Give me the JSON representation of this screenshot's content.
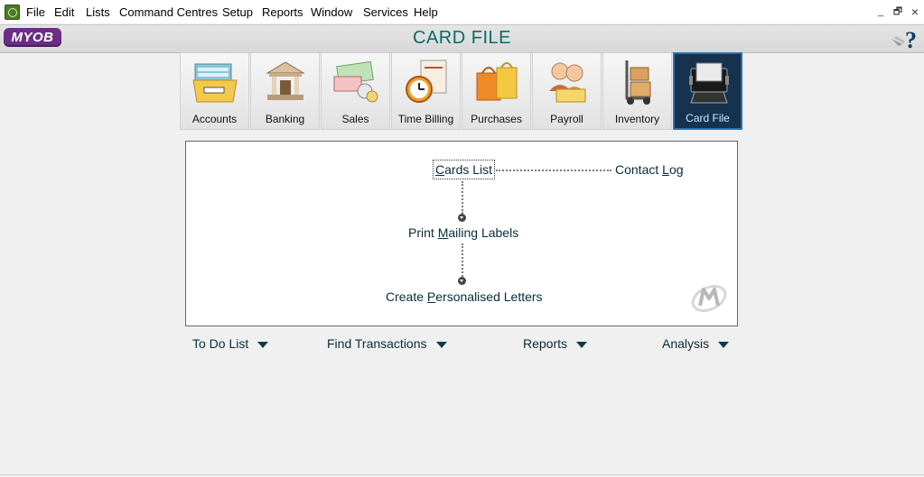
{
  "menu": {
    "items": [
      "File",
      "Edit",
      "Lists",
      "Command Centres",
      "Setup",
      "Reports",
      "Window",
      "Services",
      "Help"
    ]
  },
  "window_controls": {
    "minimize": "_",
    "restore": "🗗",
    "close": "×"
  },
  "titlebar": {
    "logo": "MYOB",
    "title": "CARD FILE",
    "help_icon": "help-question-icon"
  },
  "toolbar": {
    "buttons": [
      {
        "label": "Accounts",
        "icon": "accounts-folder-icon"
      },
      {
        "label": "Banking",
        "icon": "bank-building-icon"
      },
      {
        "label": "Sales",
        "icon": "sales-money-icon"
      },
      {
        "label": "Time Billing",
        "icon": "time-billing-clock-icon"
      },
      {
        "label": "Purchases",
        "icon": "purchases-bags-icon"
      },
      {
        "label": "Payroll",
        "icon": "payroll-people-icon"
      },
      {
        "label": "Inventory",
        "icon": "inventory-trolley-icon"
      },
      {
        "label": "Card File",
        "icon": "card-file-rolodex-icon"
      }
    ],
    "active": "Card File"
  },
  "flow": {
    "cards_list": {
      "pre": "",
      "ul": "C",
      "post": "ards List"
    },
    "contact_log": {
      "pre": "Contact ",
      "ul": "L",
      "post": "og"
    },
    "print_mailing_labels": {
      "pre": "Print ",
      "ul": "M",
      "post": "ailing Labels"
    },
    "create_personalised_letters": {
      "pre": "Create ",
      "ul": "P",
      "post": "ersonalised Letters"
    }
  },
  "bottom": {
    "todo": "To Do List",
    "find_transactions": "Find Transactions",
    "reports": "Reports",
    "analysis": "Analysis"
  },
  "colors": {
    "title": "#0a6a6a",
    "logo_bg": "#6b2d86",
    "active_tab": "#16324e",
    "link": "#082c3a"
  }
}
